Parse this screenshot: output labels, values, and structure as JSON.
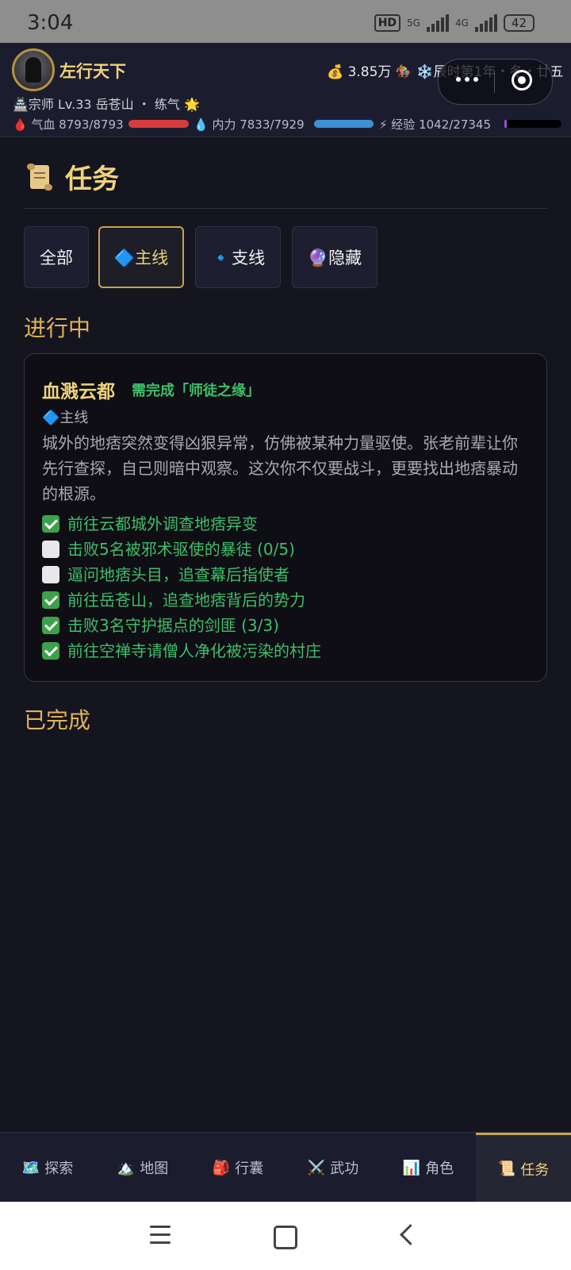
{
  "status_bar": {
    "time": "3:04",
    "hd": "HD",
    "net1": "5G",
    "net2": "4G",
    "battery": "42"
  },
  "player": {
    "name": "左行天下",
    "money": "💰 3.85万",
    "mount": "🏇",
    "time_info": "❄️辰时第1年・冬・廿五",
    "rank_line": "🏯宗师 Lv.33 岳苍山 ・ 练气 🌟",
    "hp_label": "🩸 气血 8793/8793",
    "mp_label": "💧 内力 7833/7929",
    "xp_label": "⚡ 经验 1042/27345",
    "hp_fraction": 1.0,
    "mp_fraction": 0.988,
    "xp_fraction": 0.038
  },
  "page": {
    "title": "任务"
  },
  "tabs": [
    {
      "label": "全部",
      "active": false
    },
    {
      "label": "🔷主线",
      "active": true
    },
    {
      "label": "🔹支线",
      "active": false
    },
    {
      "label": "🔮隐藏",
      "active": false
    }
  ],
  "sections": {
    "in_progress": "进行中",
    "completed": "已完成"
  },
  "quest": {
    "title": "血溅云都",
    "requirement": "需完成「师徒之缘」",
    "type": "🔷主线",
    "description": "城外的地痞突然变得凶狠异常，仿佛被某种力量驱使。张老前辈让你先行查探，自己则暗中观察。这次你不仅要战斗，更要找出地痞暴动的根源。",
    "objectives": [
      {
        "text": "前往云都城外调查地痞异变",
        "done": true
      },
      {
        "text": "击败5名被邪术驱使的暴徒 (0/5)",
        "done": false
      },
      {
        "text": "逼问地痞头目，追查幕后指使者",
        "done": false
      },
      {
        "text": "前往岳苍山，追查地痞背后的势力",
        "done": true
      },
      {
        "text": "击败3名守护据点的剑匪 (3/3)",
        "done": true
      },
      {
        "text": "前往空禅寺请僧人净化被污染的村庄",
        "done": true
      }
    ]
  },
  "nav": [
    {
      "icon": "🗺️",
      "label": "探索",
      "active": false
    },
    {
      "icon": "🏔️",
      "label": "地图",
      "active": false
    },
    {
      "icon": "🎒",
      "label": "行囊",
      "active": false
    },
    {
      "icon": "⚔️",
      "label": "武功",
      "active": false
    },
    {
      "icon": "📊",
      "label": "角色",
      "active": false
    },
    {
      "icon": "📜",
      "label": "任务",
      "active": true
    }
  ],
  "colors": {
    "gold": "#f0d27a",
    "green": "#3fbf6a",
    "hp": "#d63c3c",
    "mp": "#3d8fd6",
    "xp": "#9a4fd6"
  }
}
